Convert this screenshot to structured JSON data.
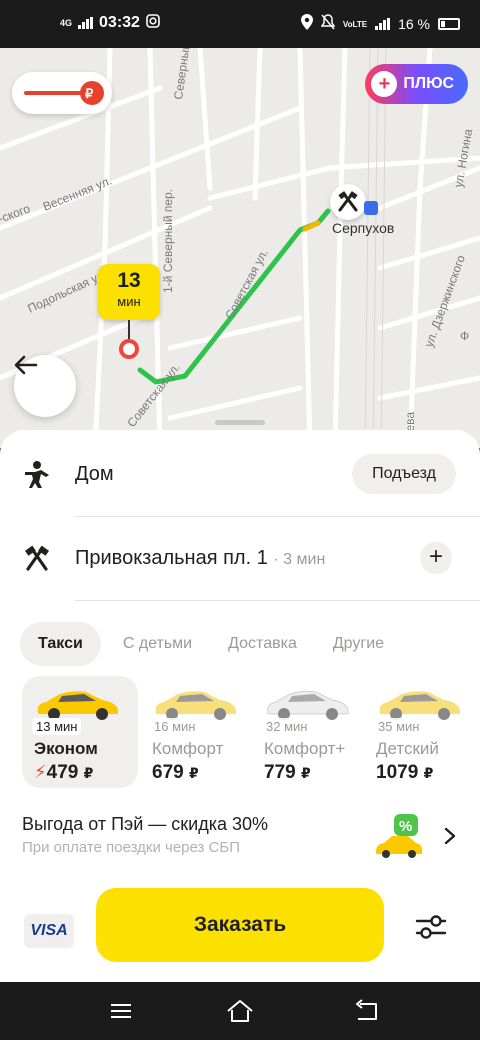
{
  "status_bar": {
    "network": "4G",
    "time": "03:32",
    "volte": "VoLTE",
    "battery": "16 %"
  },
  "map": {
    "streets": [
      "Весенняя ул.",
      "Подольская ул.",
      "Советская ул.",
      "Советская ул.",
      "Северный пр-д",
      "1-й Северный пер.",
      "ул. Ногина",
      "ул. Дзержинского",
      "-ского",
      "Ф",
      "яева"
    ],
    "plus_label": "ПЛЮС",
    "eta_value": "13",
    "eta_unit": "мин",
    "destination_label": "Серпухов"
  },
  "route": {
    "from": "Дом",
    "entrance_button": "Подъезд",
    "to": "Привокзальная пл. 1",
    "to_eta": "· 3 мин"
  },
  "tabs": [
    {
      "label": "Такси",
      "active": true
    },
    {
      "label": "С детьми",
      "active": false
    },
    {
      "label": "Доставка",
      "active": false
    },
    {
      "label": "Другие",
      "active": false
    }
  ],
  "tariffs": [
    {
      "time": "13 мин",
      "name": "Эконом",
      "price": "479",
      "currency": "₽",
      "surge": "⚡",
      "active": true
    },
    {
      "time": "16 мин",
      "name": "Комфорт",
      "price": "679",
      "currency": "₽",
      "active": false
    },
    {
      "time": "32 мин",
      "name": "Комфорт+",
      "price": "779",
      "currency": "₽",
      "active": false
    },
    {
      "time": "35 мин",
      "name": "Детский",
      "price": "1079",
      "currency": "₽",
      "active": false
    }
  ],
  "promo": {
    "title": "Выгода от Пэй — скидка 30%",
    "subtitle": "При оплате поездки через СБП",
    "badge": "%"
  },
  "bottom": {
    "payment": "VISA",
    "order_button": "Заказать"
  },
  "colors": {
    "accent_yellow": "#fce000",
    "route_green": "#2fc34d",
    "origin_red": "#f0473a"
  }
}
